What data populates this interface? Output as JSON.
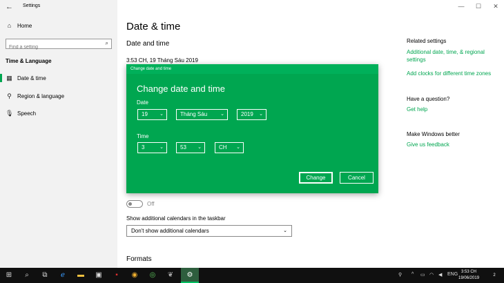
{
  "window": {
    "title": "Settings",
    "back_glyph": "←",
    "minimize_glyph": "—",
    "maximize_glyph": "☐",
    "close_glyph": "✕"
  },
  "sidebar": {
    "home_label": "Home",
    "search_placeholder": "Find a setting",
    "section": "Time & Language",
    "items": [
      {
        "label": "Date & time",
        "icon": "calendar-clock-icon",
        "active": true
      },
      {
        "label": "Region & language",
        "icon": "region-icon",
        "active": false
      },
      {
        "label": "Speech",
        "icon": "microphone-icon",
        "active": false
      }
    ]
  },
  "main": {
    "title": "Date & time",
    "subtitle": "Date and time",
    "current_datetime": "3:53 CH, 19 Tháng Sáu 2019",
    "daylight_toggle_state": "Off",
    "calendars_label": "Show additional calendars in the taskbar",
    "calendars_value": "Don't show additional calendars",
    "formats_heading": "Formats"
  },
  "related": {
    "heading": "Related settings",
    "links": [
      "Additional date, time, & regional settings",
      "Add clocks for different time zones"
    ],
    "question_heading": "Have a question?",
    "question_link": "Get help",
    "better_heading": "Make Windows better",
    "better_link": "Give us feedback"
  },
  "dialog": {
    "titlebar": "Change date and time",
    "heading": "Change date and time",
    "date_label": "Date",
    "day": "19",
    "month": "Tháng Sáu",
    "year": "2019",
    "time_label": "Time",
    "hour": "3",
    "minute": "53",
    "ampm": "CH",
    "change_button": "Change",
    "cancel_button": "Cancel"
  },
  "taskbar": {
    "language": "ENG",
    "time": "3:53 CH",
    "date": "19/06/2019",
    "notification_count": "2"
  },
  "colors": {
    "accent": "#00a650",
    "dialog_bg": "#00a650",
    "sidebar_bg": "#f2f2f2",
    "taskbar_bg": "#101010"
  }
}
